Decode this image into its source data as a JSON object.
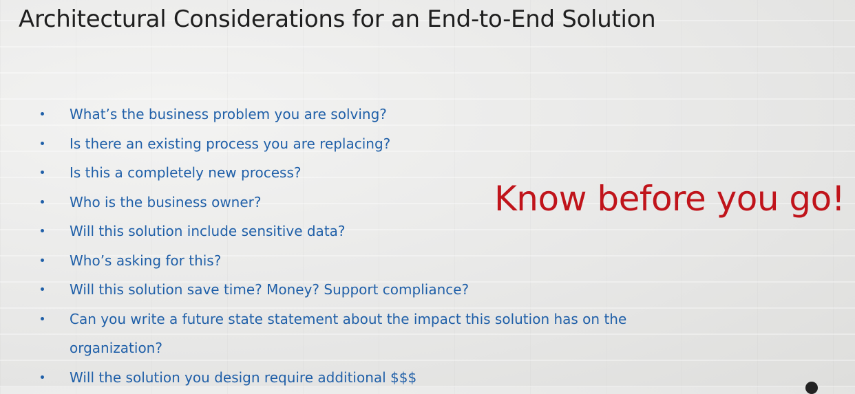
{
  "slide": {
    "title": "Architectural Considerations for an End-to-End Solution",
    "bullets": [
      "What’s the business problem you are solving?",
      "Is there an existing process you are replacing?",
      "Is this a completely new process?",
      "Who is the business owner?",
      "Will this solution include sensitive data?",
      "Who’s asking for this?",
      "Will this solution save time? Money? Support compliance?",
      "Can you write a future state statement about the impact this solution has on the organization?",
      "Will the solution you design require additional $$$"
    ],
    "callout": "Know before you go!"
  },
  "colors": {
    "title": "#1f1f1f",
    "bullet_text": "#1f5fa8",
    "callout": "#c0141b"
  }
}
